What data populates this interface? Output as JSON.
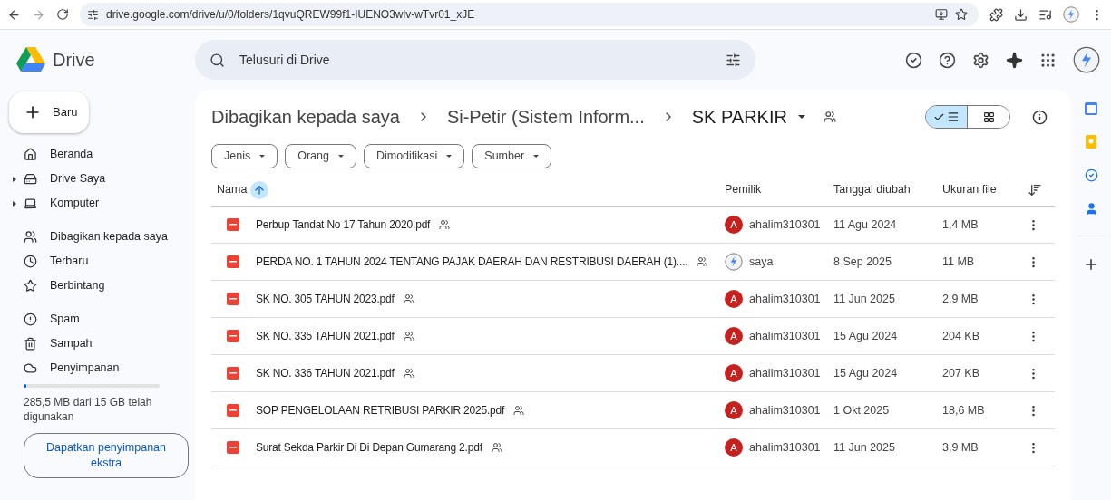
{
  "browser": {
    "url": "drive.google.com/drive/u/0/folders/1qvuQREW99f1-IUENO3wlv-wTvr01_xJE"
  },
  "app": {
    "name": "Drive",
    "search_placeholder": "Telusuri di Drive"
  },
  "sidebar": {
    "new_button": "Baru",
    "groups": [
      [
        {
          "label": "Beranda",
          "expandable": false
        },
        {
          "label": "Drive Saya",
          "expandable": true
        },
        {
          "label": "Komputer",
          "expandable": true
        }
      ],
      [
        {
          "label": "Dibagikan kepada saya",
          "expandable": false
        },
        {
          "label": "Terbaru",
          "expandable": false
        },
        {
          "label": "Berbintang",
          "expandable": false
        }
      ],
      [
        {
          "label": "Spam",
          "expandable": false
        },
        {
          "label": "Sampah",
          "expandable": false
        },
        {
          "label": "Penyimpanan",
          "expandable": false
        }
      ]
    ],
    "storage": {
      "level": 0.02,
      "text": "285,5 MB dari 15 GB telah digunakan",
      "button": "Dapatkan penyimpanan ekstra"
    }
  },
  "breadcrumb": [
    "Dibagikan kepada saya",
    "Si-Petir (Sistem Inform..."
  ],
  "folder_title": "SK PARKIR",
  "view_toggle": [
    {
      "kind": "list",
      "selected": true
    },
    {
      "kind": "grid",
      "selected": false
    }
  ],
  "filters": [
    "Jenis",
    "Orang",
    "Dimodifikasi",
    "Sumber"
  ],
  "table": {
    "columns": [
      "Nama",
      "Pemilik",
      "Tanggal diubah",
      "Ukuran file"
    ],
    "sort_ascending": true,
    "rows": [
      {
        "name": "Perbup Tandat No 17 Tahun 2020.pdf",
        "owner": "ahalim310301",
        "owner_avatar": {
          "kind": "letter",
          "letter": "A"
        },
        "modified": "11 Agu 2024",
        "size": "1,4 MB"
      },
      {
        "name": "PERDA NO. 1 TAHUN 2024 TENTANG PAJAK DAERAH DAN RESTRIBUSI DAERAH (1)....",
        "owner": "saya",
        "owner_avatar": {
          "kind": "photo"
        },
        "modified": "8 Sep 2025",
        "size": "11 MB"
      },
      {
        "name": "SK NO. 305 TAHUN 2023.pdf",
        "owner": "ahalim310301",
        "owner_avatar": {
          "kind": "letter",
          "letter": "A"
        },
        "modified": "11 Jun 2025",
        "size": "2,9 MB"
      },
      {
        "name": "SK NO. 335 TAHUN 2021.pdf",
        "owner": "ahalim310301",
        "owner_avatar": {
          "kind": "letter",
          "letter": "A"
        },
        "modified": "15 Agu 2024",
        "size": "204 KB"
      },
      {
        "name": "SK NO. 336 TAHUN 2021.pdf",
        "owner": "ahalim310301",
        "owner_avatar": {
          "kind": "letter",
          "letter": "A"
        },
        "modified": "15 Agu 2024",
        "size": "207 KB"
      },
      {
        "name": "SOP PENGELOLAAN RETRIBUSI PARKIR 2025.pdf",
        "owner": "ahalim310301",
        "owner_avatar": {
          "kind": "letter",
          "letter": "A"
        },
        "modified": "1 Okt 2025",
        "size": "18,6 MB"
      },
      {
        "name": "Surat Sekda Parkir Di Di Depan Gumarang 2.pdf",
        "owner": "ahalim310301",
        "owner_avatar": {
          "kind": "letter",
          "letter": "A"
        },
        "modified": "11 Jun 2025",
        "size": "3,9 MB"
      }
    ]
  }
}
